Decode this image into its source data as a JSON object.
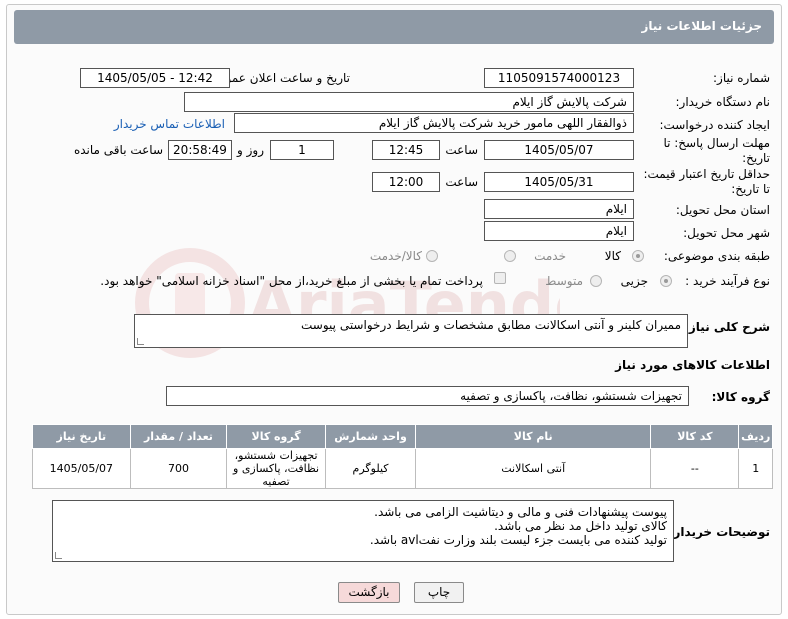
{
  "header": {
    "title": "جزئیات اطلاعات نیاز"
  },
  "fields": {
    "need_number_label": "شماره نیاز:",
    "need_number": "1105091574000123",
    "announce_label": "تاریخ و ساعت اعلان عمومی:",
    "announce_value": "1405/05/05 - 12:42",
    "buyer_org_label": "نام دستگاه خریدار:",
    "buyer_org": "شرکت پالایش گاز ایلام",
    "requester_label": "ایجاد کننده درخواست:",
    "requester": "ذوالفقار اللهی مامور خرید شرکت پالایش گاز ایلام",
    "contact_link": "اطلاعات تماس خریدار",
    "reply_deadline_label": "مهلت ارسال پاسخ: تا تاریخ:",
    "reply_date": "1405/05/07",
    "time_label": "ساعت",
    "reply_time": "12:45",
    "days_value": "1",
    "days_label": "روز و",
    "remaining_value": "20:58:49",
    "remaining_label": "ساعت باقی مانده",
    "price_validity_label": "حداقل تاریخ اعتبار قیمت: تا تاریخ:",
    "price_date": "1405/05/31",
    "price_time": "12:00",
    "province_label": "استان محل تحویل:",
    "province": "ایلام",
    "city_label": "شهر محل تحویل:",
    "city": "ایلام",
    "category_label": "طبقه بندی موضوعی:",
    "category_options": [
      "کالا",
      "خدمت",
      "کالا/خدمت"
    ],
    "process_label": "نوع فرآیند خرید :",
    "process_options": [
      "جزیی",
      "متوسط"
    ],
    "payment_note": "پرداخت تمام یا بخشی از مبلغ خرید،از محل \"اسناد خزانه اسلامی\" خواهد بود.",
    "desc_label": "شرح کلی نیاز:",
    "desc_value": "ممیران کلینر و آنتی اسکالانت مطابق مشخصات و شرایط درخواستی پیوست",
    "goods_info_title": "اطلاعات کالاهای مورد نیاز",
    "goods_group_label": "گروه کالا:",
    "goods_group": "تجهیزات شستشو، نظافت، پاکسازی و تصفیه"
  },
  "table": {
    "headers": [
      "ردیف",
      "کد کالا",
      "نام کالا",
      "واحد شمارش",
      "گروه کالا",
      "تعداد / مقدار",
      "تاریخ نیاز"
    ],
    "rows": [
      [
        "1",
        "--",
        "آنتی اسکالانت",
        "کیلوگرم",
        "تجهیزات شستشو، نظافت، پاکسازی و تصفیه",
        "700",
        "1405/05/07"
      ]
    ]
  },
  "buyer_notes": {
    "label": "توضیحات خریدار:",
    "lines": [
      "پیوست پیشنهادات فنی و مالی و دیتاشیت الزامی می باشد.",
      "کالای تولید داخل مد نظر می باشد.",
      "تولید کننده می بایست جزء لیست بلند وزارت نفتavl باشد."
    ]
  },
  "buttons": {
    "print": "چاپ",
    "back": "بازگشت"
  },
  "watermark": {
    "text": "AriaTender.net"
  },
  "colors": {
    "header_bg": "#8f9aa6",
    "link": "#1a5fb4",
    "back_btn": "#f6d9d9"
  }
}
